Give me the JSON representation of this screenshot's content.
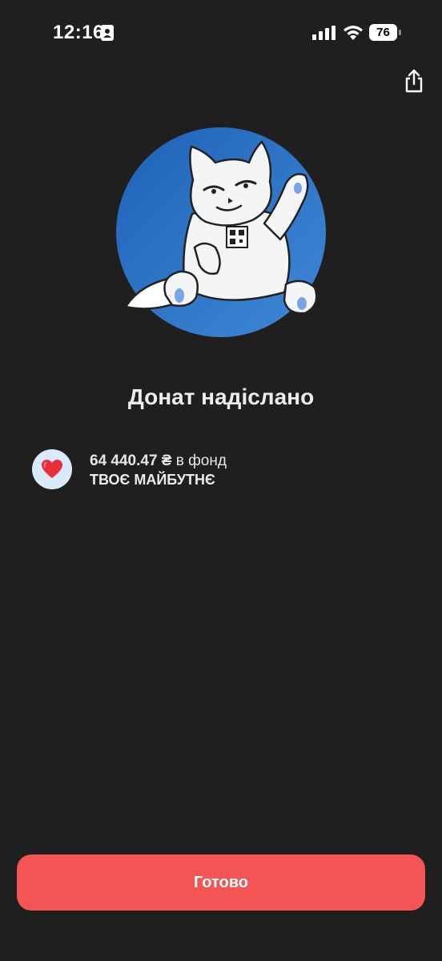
{
  "status_bar": {
    "time": "12:16",
    "battery_level": "76",
    "icons": [
      "contact-card-icon",
      "cellular-signal-icon",
      "wifi-icon",
      "battery-icon"
    ]
  },
  "header": {
    "share_icon": "share-icon"
  },
  "illustration": {
    "name": "cat-mascot",
    "background_color": "#2f73c8"
  },
  "title": "Донат надіслано",
  "donation": {
    "icon": "red-heart-icon",
    "amount": "64 440.47 ₴",
    "amount_suffix": " в фонд",
    "fund_name": "ТВОЄ МАЙБУТНЄ"
  },
  "actions": {
    "done_label": "Готово"
  },
  "colors": {
    "background": "#1f1f1f",
    "accent": "#f45453",
    "avatar_bg": "#d9ebfb"
  }
}
